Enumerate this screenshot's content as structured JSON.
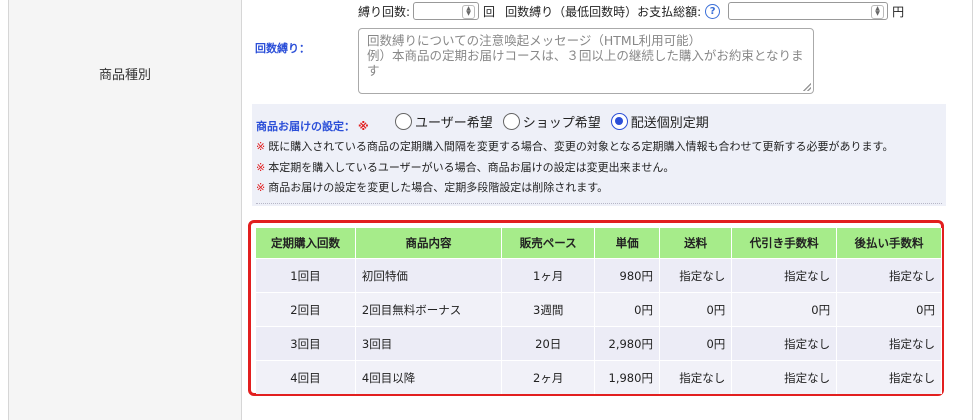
{
  "field_label": "商品種別",
  "top_row": {
    "count_label": "縛り回数:",
    "count_unit": "回",
    "total_label": "回数縛り（最低回数時）お支払総額:",
    "total_unit": "円"
  },
  "repetition": {
    "label": "回数縛り：",
    "placeholder": "回数縛りについての注意喚起メッセージ（HTML利用可能）\n例）本商品の定期お届けコースは、３回以上の継続した購入がお約束となります"
  },
  "delivery": {
    "label": "商品お届けの設定：",
    "required_mark": "※",
    "options": [
      "ユーザー希望",
      "ショップ希望",
      "配送個別定期"
    ],
    "selected": "配送個別定期",
    "notes": [
      "既に購入されている商品の定期購入間隔を変更する場合、変更の対象となる定期購入情報も合わせて更新する必要があります。",
      "本定期を購入しているユーザーがいる場合、商品お届けの設定は変更出来ません。",
      "商品お届けの設定を変更した場合、定期多段階設定は削除されます。"
    ],
    "note_mark": "※"
  },
  "schedule": {
    "headers": [
      "定期購入回数",
      "商品内容",
      "販売ペース",
      "単価",
      "送料",
      "代引き手数料",
      "後払い手数料"
    ],
    "rows": [
      [
        "1回目",
        "初回特価",
        "1ヶ月",
        "980円",
        "指定なし",
        "指定なし",
        "指定なし"
      ],
      [
        "2回目",
        "2回目無料ボーナス",
        "3週間",
        "0円",
        "0円",
        "0円",
        "0円"
      ],
      [
        "3回目",
        "3回目",
        "20日",
        "2,980円",
        "0円",
        "指定なし",
        "指定なし"
      ],
      [
        "4回目",
        "4回目以降",
        "2ヶ月",
        "1,980円",
        "指定なし",
        "指定なし",
        "指定なし"
      ]
    ]
  },
  "colors": {
    "accent_blue": "#2b4fd8",
    "required_red": "#e21f1f",
    "header_green": "#a6ec8a",
    "highlight_border": "#e21f1f"
  },
  "icons": {
    "help": "question-circle-icon",
    "spinner": "spinner-arrows-icon"
  }
}
